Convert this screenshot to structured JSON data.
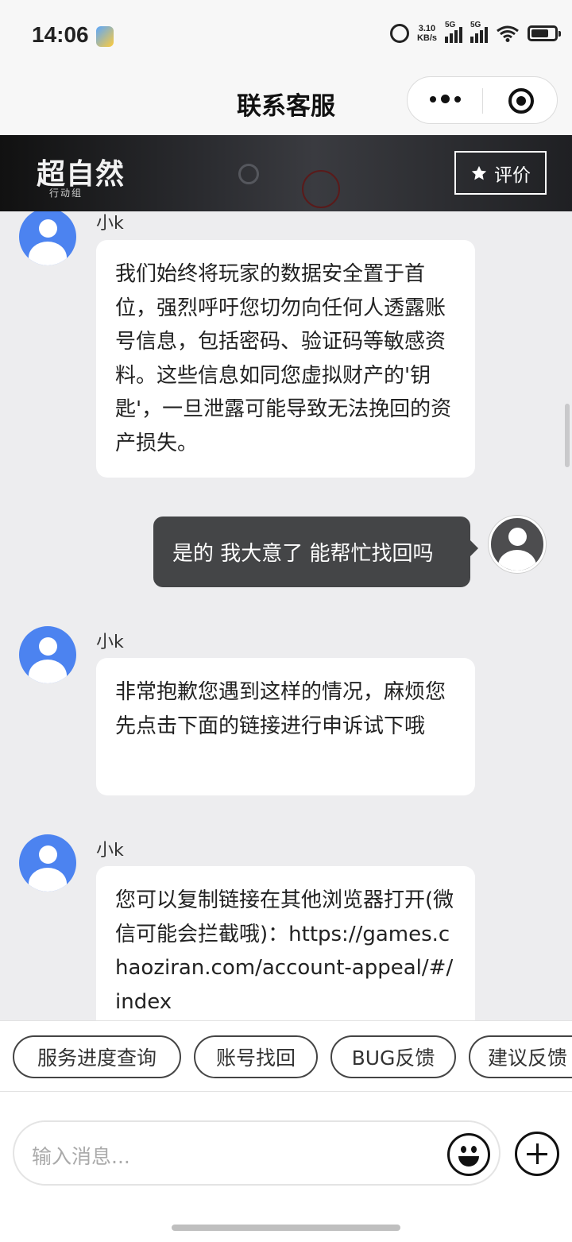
{
  "status": {
    "time": "14:06",
    "speed_value": "3.10",
    "speed_unit": "KB/s",
    "sim1": "5G",
    "sim2": "5G",
    "battery_level": 0.75
  },
  "header": {
    "title": "联系客服",
    "more_icon": "more-dots-icon",
    "close_icon": "target-icon"
  },
  "banner": {
    "logo_text": "超自然",
    "logo_sub": "行动组",
    "rate_label": "评价",
    "rate_icon": "star-icon"
  },
  "messages": [
    {
      "sender": "agent",
      "name": "小k",
      "text": "我们始终将玩家的数据安全置于首位，强烈呼吁您切勿向任何人透露账号信息，包括密码、验证码等敏感资料。这些信息如同您虚拟财产的'钥匙'，一旦泄露可能导致无法挽回的资产损失。"
    },
    {
      "sender": "user",
      "text": "是的 我大意了 能帮忙找回吗"
    },
    {
      "sender": "agent",
      "name": "小k",
      "text": "非常抱歉您遇到这样的情况，麻烦您先点击下面的链接进行申诉试下哦"
    },
    {
      "sender": "agent",
      "name": "小k",
      "text": "您可以复制链接在其他浏览器打开(微信可能会拦截哦)：https://games.chaoziran.com/account-appeal/#/index"
    }
  ],
  "quick_replies": [
    "服务进度查询",
    "账号找回",
    "BUG反馈",
    "建议反馈"
  ],
  "input": {
    "placeholder": "输入消息...",
    "emoji_icon": "emoji-icon",
    "plus_icon": "plus-icon"
  },
  "colors": {
    "agent_avatar": "#4c83f0",
    "user_bubble": "#444547",
    "background": "#ededef"
  }
}
